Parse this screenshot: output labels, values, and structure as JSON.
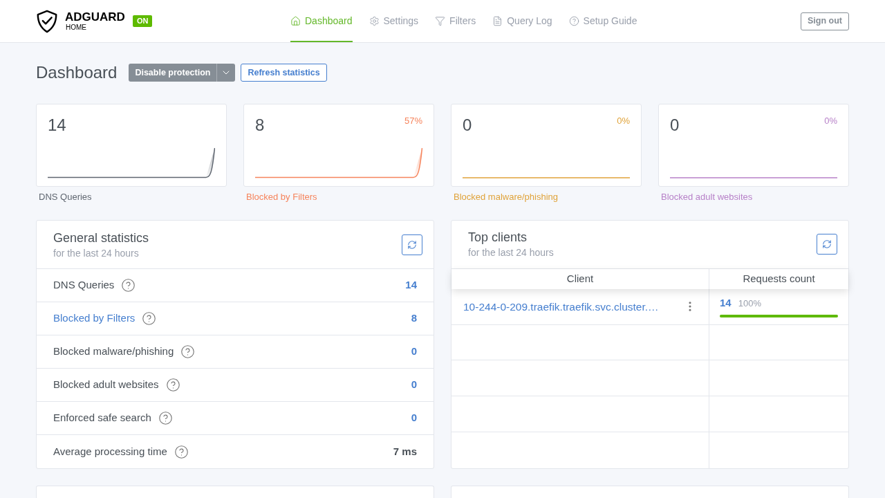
{
  "header": {
    "logo": {
      "title": "ADGUARD",
      "subtitle": "HOME"
    },
    "status_badge": "ON",
    "nav": [
      {
        "label": "Dashboard",
        "selected": true
      },
      {
        "label": "Settings",
        "selected": false
      },
      {
        "label": "Filters",
        "selected": false
      },
      {
        "label": "Query Log",
        "selected": false
      },
      {
        "label": "Setup Guide",
        "selected": false
      }
    ],
    "sign_out": "Sign out"
  },
  "page": {
    "title": "Dashboard",
    "protection_button": "Disable protection",
    "refresh_button": "Refresh statistics"
  },
  "stat_cards": [
    {
      "value": "14",
      "label": "DNS Queries",
      "color": "#5f6670",
      "kind": "spike"
    },
    {
      "value": "8",
      "percent": "57%",
      "label": "Blocked by Filters",
      "color": "#f6845c",
      "kind": "spike"
    },
    {
      "value": "0",
      "percent": "0%",
      "label": "Blocked malware/phishing",
      "color": "#e0a33a",
      "kind": "flat"
    },
    {
      "value": "0",
      "percent": "0%",
      "label": "Blocked adult websites",
      "color": "#b780c8",
      "kind": "flat"
    }
  ],
  "general_statistics": {
    "title": "General statistics",
    "subtitle": "for the last 24 hours",
    "rows": [
      {
        "label": "DNS Queries",
        "value": "14",
        "label_link": false,
        "value_link": true
      },
      {
        "label": "Blocked by Filters",
        "value": "8",
        "label_link": true,
        "value_link": true
      },
      {
        "label": "Blocked malware/phishing",
        "value": "0",
        "label_link": false,
        "value_link": true
      },
      {
        "label": "Blocked adult websites",
        "value": "0",
        "label_link": false,
        "value_link": true
      },
      {
        "label": "Enforced safe search",
        "value": "0",
        "label_link": false,
        "value_link": true
      },
      {
        "label": "Average processing time",
        "value": "7 ms",
        "label_link": false,
        "value_link": false
      }
    ]
  },
  "top_clients": {
    "title": "Top clients",
    "subtitle": "for the last 24 hours",
    "columns": [
      "Client",
      "Requests count"
    ],
    "rows": [
      {
        "client": "10-244-0-209.traefik.traefik.svc.cluster.…",
        "count": "14",
        "percent": "100%",
        "level": 1
      }
    ]
  }
}
